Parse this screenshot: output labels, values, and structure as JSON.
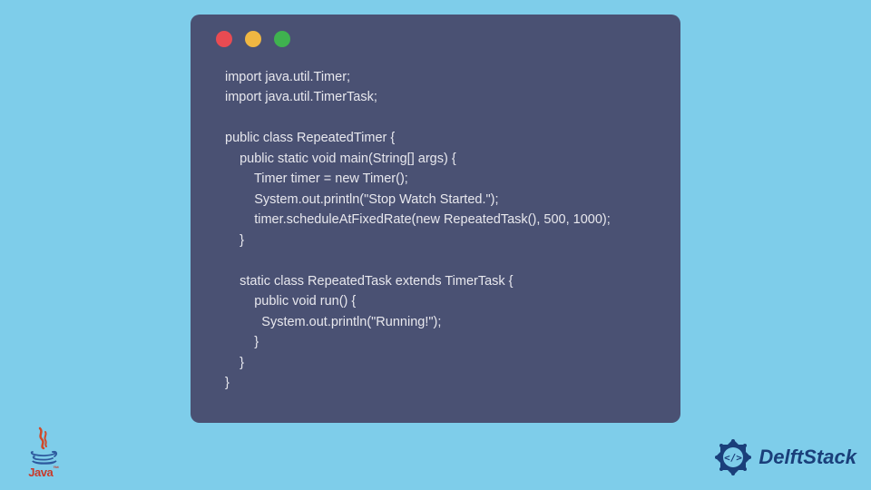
{
  "window": {
    "dots": [
      "red",
      "yellow",
      "green"
    ]
  },
  "code": {
    "lines": [
      "import java.util.Timer;",
      "import java.util.TimerTask;",
      "",
      "public class RepeatedTimer {",
      "    public static void main(String[] args) {",
      "        Timer timer = new Timer();",
      "        System.out.println(\"Stop Watch Started.\");",
      "        timer.scheduleAtFixedRate(new RepeatedTask(), 500, 1000);",
      "    }",
      "",
      "    static class RepeatedTask extends TimerTask {",
      "        public void run() {",
      "          System.out.println(\"Running!\");",
      "        }",
      "    }",
      "}"
    ]
  },
  "logos": {
    "java_label": "Java",
    "java_tm": "™",
    "delft_label": "DelftStack"
  },
  "colors": {
    "page_bg": "#7ecdea",
    "window_bg": "#4a5173",
    "code_fg": "#e8e8ee",
    "dot_red": "#e94b52",
    "dot_yellow": "#f0b742",
    "dot_green": "#3fb24f",
    "java_red": "#c93a2a",
    "delft_blue": "#1a3f7a"
  }
}
